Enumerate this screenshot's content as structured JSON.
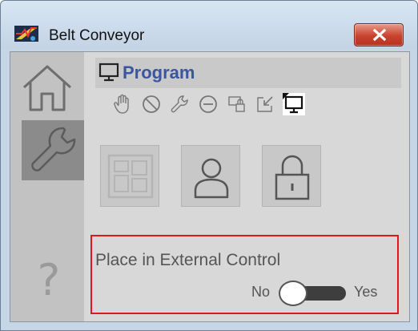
{
  "window": {
    "title": "Belt Conveyor",
    "icons": {
      "app": "belt-conveyor-app-icon",
      "close": "close-icon"
    }
  },
  "sidebar": {
    "items": [
      {
        "icon": "home-icon"
      },
      {
        "icon": "wrench-icon",
        "selected": true
      },
      {
        "icon": "help-icon",
        "glyph": "?"
      }
    ]
  },
  "program": {
    "title": "Program",
    "icon": "monitor-icon",
    "mode_icons": [
      {
        "icon": "hand-icon"
      },
      {
        "icon": "prohibit-icon"
      },
      {
        "icon": "maintenance-wrench-icon"
      },
      {
        "icon": "minus-circle-icon"
      },
      {
        "icon": "locked-program-icon"
      },
      {
        "icon": "external-arrow-icon"
      },
      {
        "icon": "program-monitor-icon",
        "active": true
      }
    ],
    "big_buttons": [
      {
        "icon": "faceplate-icon",
        "disabled": true
      },
      {
        "icon": "operator-user-icon"
      },
      {
        "icon": "padlock-icon"
      }
    ]
  },
  "external_control": {
    "label": "Place in External Control",
    "off_label": "No",
    "on_label": "Yes",
    "value": "No"
  },
  "colors": {
    "title_accent": "#3a56a0",
    "highlight_border": "#e0171c",
    "close_button": "#c8432f"
  }
}
